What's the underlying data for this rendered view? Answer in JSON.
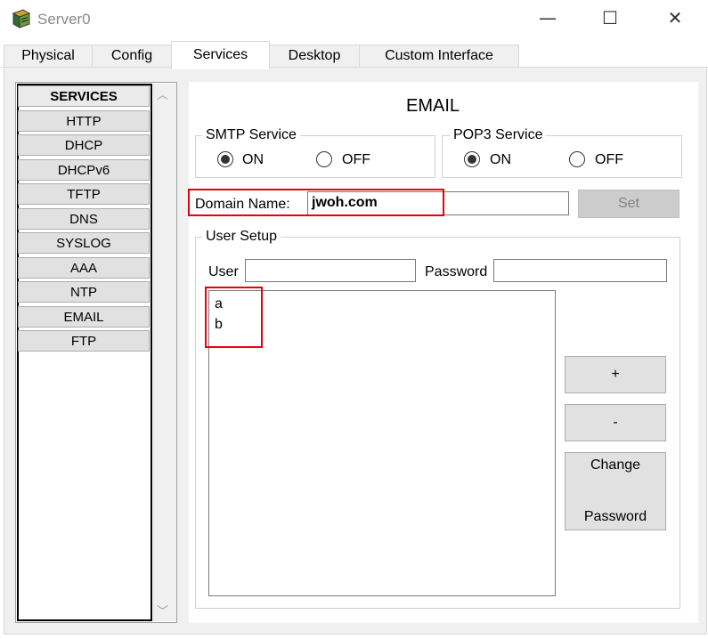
{
  "window": {
    "title": "Server0",
    "app_icon": "server-icon",
    "controls": {
      "minimize": "—",
      "maximize": "☐",
      "close": "✕"
    }
  },
  "tabs": [
    {
      "label": "Physical",
      "active": false
    },
    {
      "label": "Config",
      "active": false
    },
    {
      "label": "Services",
      "active": true
    },
    {
      "label": "Desktop",
      "active": false
    },
    {
      "label": "Custom Interface",
      "active": false
    }
  ],
  "services": {
    "header": "SERVICES",
    "items": [
      "HTTP",
      "DHCP",
      "DHCPv6",
      "TFTP",
      "DNS",
      "SYSLOG",
      "AAA",
      "NTP",
      "EMAIL",
      "FTP"
    ]
  },
  "email": {
    "heading": "EMAIL",
    "smtp": {
      "title": "SMTP Service",
      "on_label": "ON",
      "off_label": "OFF",
      "selected": "ON"
    },
    "pop3": {
      "title": "POP3 Service",
      "on_label": "ON",
      "off_label": "OFF",
      "selected": "ON"
    },
    "domain": {
      "label": "Domain Name:",
      "value": "jwoh.com",
      "set_label": "Set"
    },
    "user_setup": {
      "title": "User Setup",
      "user_label": "User",
      "user_value": "",
      "password_label": "Password",
      "password_value": "",
      "users": [
        "a",
        "b"
      ],
      "add_label": "+",
      "remove_label": "-",
      "change_password_line1": "Change",
      "change_password_line2": "Password"
    }
  },
  "colors": {
    "highlight": "#e8000b",
    "panel_bg": "#f0f0f0",
    "button_bg": "#e1e1e1"
  }
}
